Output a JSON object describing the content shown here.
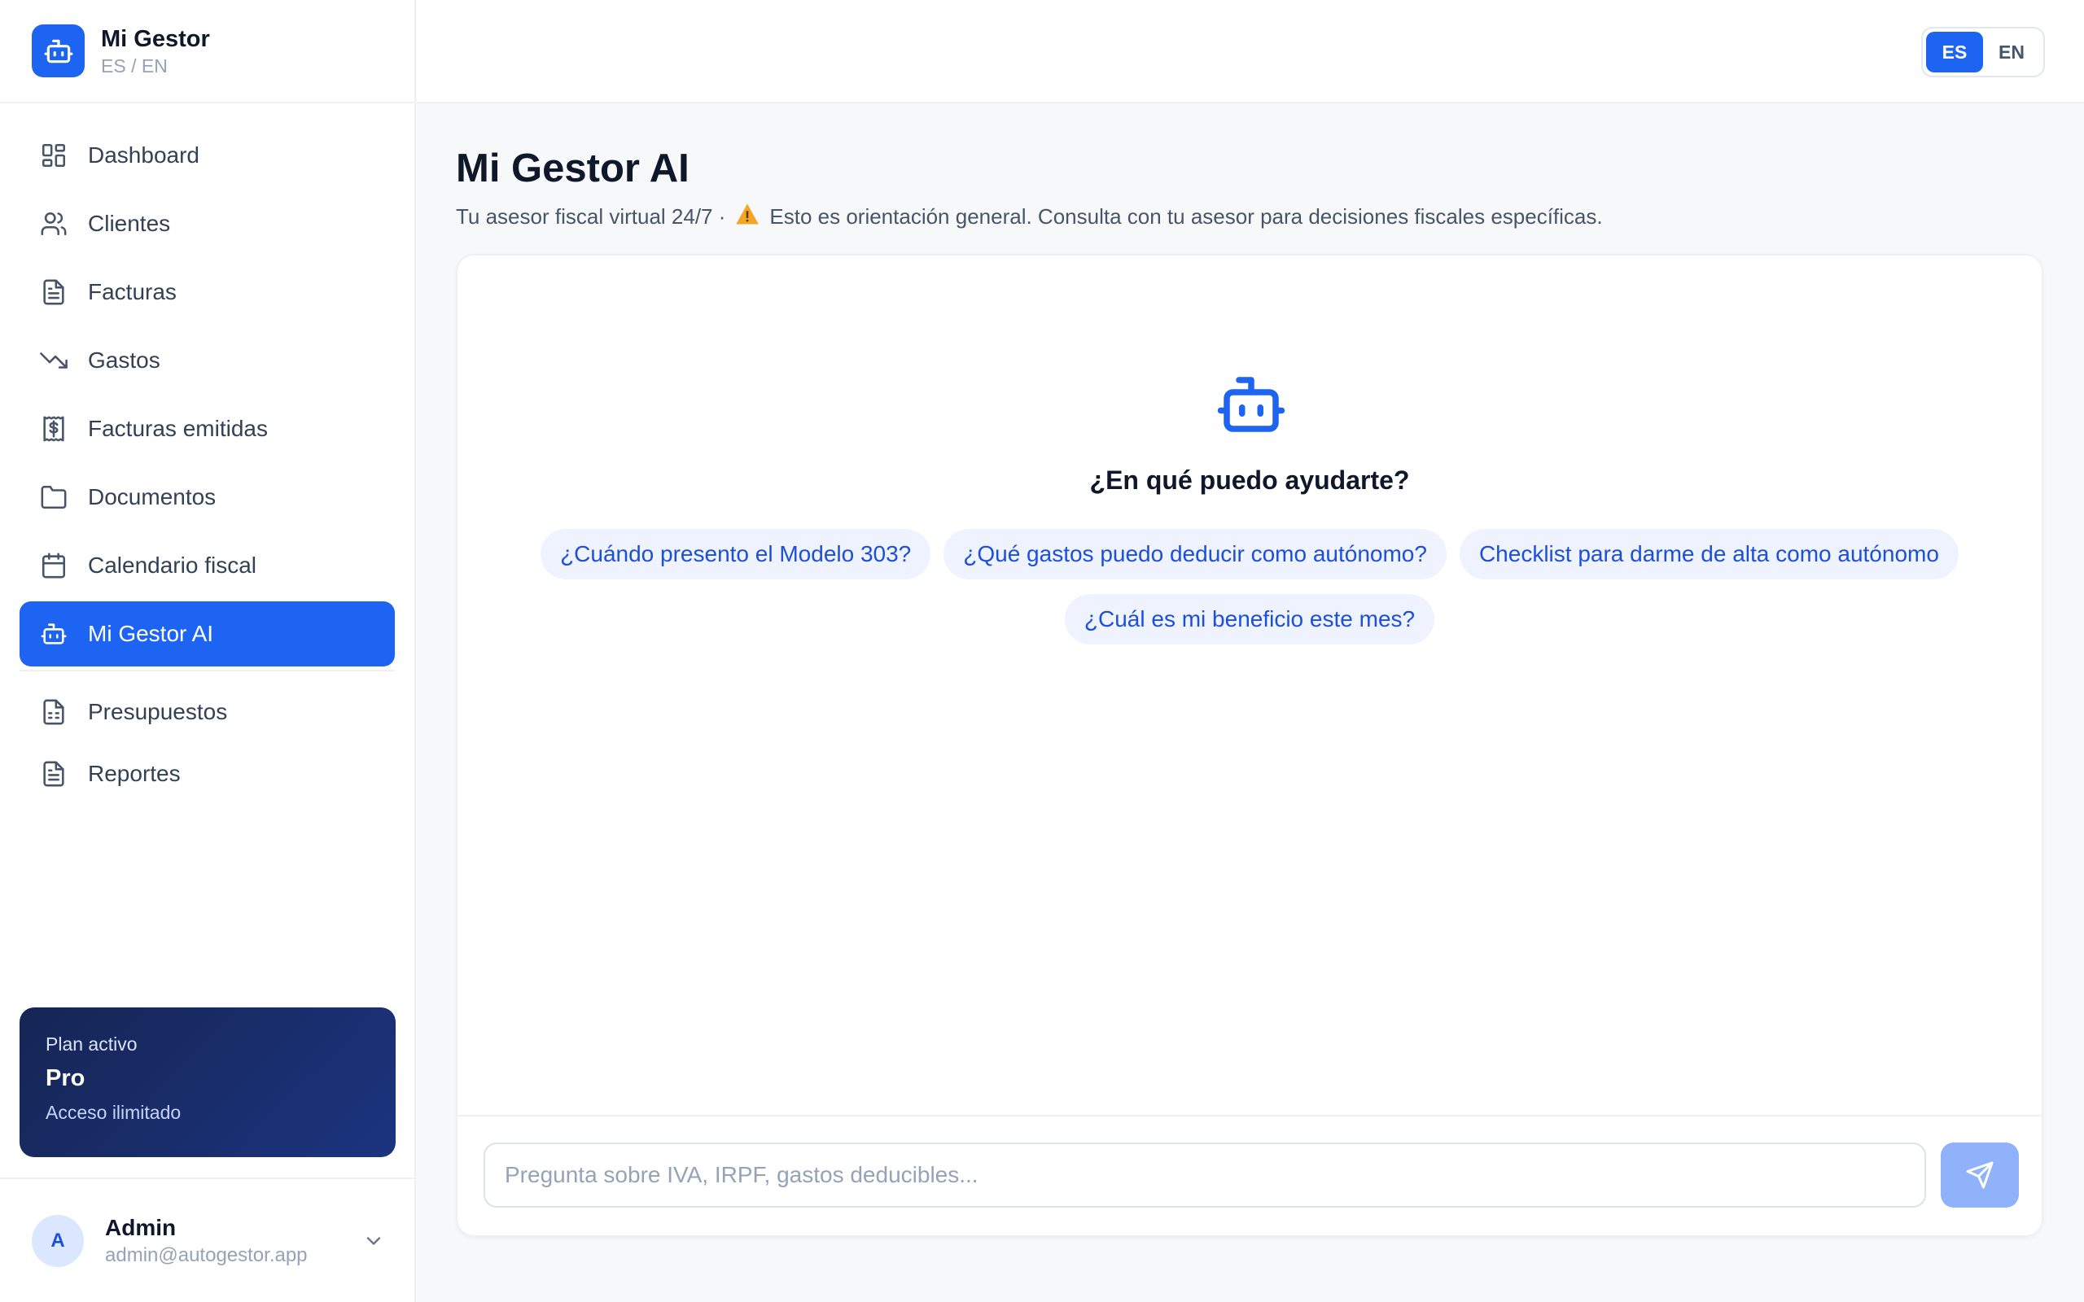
{
  "brand": {
    "name": "Mi Gestor",
    "sub": "ES / EN"
  },
  "nav": {
    "items": [
      {
        "label": "Dashboard"
      },
      {
        "label": "Clientes"
      },
      {
        "label": "Facturas"
      },
      {
        "label": "Gastos"
      },
      {
        "label": "Facturas emitidas"
      },
      {
        "label": "Documentos"
      },
      {
        "label": "Calendario fiscal"
      },
      {
        "label": "Mi Gestor AI"
      }
    ],
    "secondary": [
      {
        "label": "Presupuestos"
      },
      {
        "label": "Reportes"
      }
    ]
  },
  "plan": {
    "label": "Plan activo",
    "name": "Pro",
    "desc": "Acceso ilimitado"
  },
  "user": {
    "initial": "A",
    "name": "Admin",
    "email": "admin@autogestor.app"
  },
  "lang": {
    "es": "ES",
    "en": "EN",
    "active": "ES"
  },
  "page": {
    "title": "Mi Gestor AI",
    "subtitle_prefix": "Tu asesor fiscal virtual 24/7 ·",
    "subtitle_warning": "Esto es orientación general. Consulta con tu asesor para decisiones fiscales específicas."
  },
  "chat": {
    "heading": "¿En qué puedo ayudarte?",
    "suggestions": [
      "¿Cuándo presento el Modelo 303?",
      "¿Qué gastos puedo deducir como autónomo?",
      "Checklist para darme de alta como autónomo",
      "¿Cuál es mi beneficio este mes?"
    ],
    "placeholder": "Pregunta sobre IVA, IRPF, gastos deducibles..."
  },
  "colors": {
    "accent": "#1d64f2",
    "plan_bg": "#162554",
    "chip_bg": "#eef3ff",
    "send_disabled": "#8fb2fa"
  }
}
